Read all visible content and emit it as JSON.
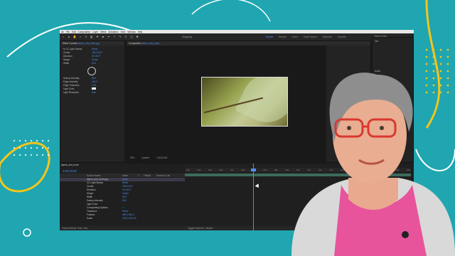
{
  "background": {
    "color": "#1fa6b0",
    "accent_yellow": "#f4c51c",
    "accent_white": "#ffffff"
  },
  "menu": [
    "Ae",
    "File",
    "Edit",
    "Composition",
    "Layer",
    "Effect",
    "Animation",
    "View",
    "Window",
    "Help"
  ],
  "toolbar": {
    "snapping": "Snapping"
  },
  "workspaces": [
    "Default",
    "Review",
    "Learn",
    "Small Screen",
    "Standard",
    "Libraries"
  ],
  "search_help": "Search Help",
  "effect_controls": {
    "tab_label": "Effect Controls",
    "layer_name": "layers_and_more.jpg",
    "rows": [
      {
        "label": "fx  CC Light Sweep",
        "value": "Reset"
      },
      {
        "label": "Center",
        "value": "196.0,91.0"
      },
      {
        "label": "Direction",
        "value": "0x+40.0°"
      },
      {
        "label": "Shape",
        "value": "Linear"
      },
      {
        "label": "Width",
        "value": "50.0"
      },
      {
        "label": "Sweep Intensity",
        "value": "50.0"
      },
      {
        "label": "Edge Intensity",
        "value": "100.0"
      },
      {
        "label": "Edge Thickness",
        "value": "2.00"
      },
      {
        "label": "Light Color",
        "value": ""
      },
      {
        "label": "Light Reception",
        "value": "Add"
      }
    ]
  },
  "composition": {
    "tab_label": "Composition",
    "comp_name": "layers_and_more",
    "breadcrumb": "layers_and_more",
    "footer": [
      "25%",
      "Quarter",
      "0;00;03;00"
    ]
  },
  "right_panel": {
    "items": [
      "Info",
      "Audio",
      "Preview",
      "Effects & Presets"
    ]
  },
  "timeline": {
    "tab_label": "layers_and_more",
    "timecode": "0;00;03;00",
    "columns": [
      "Source Name",
      "Mode",
      "T",
      "TrkMat",
      "Parent & Link"
    ],
    "layers": [
      {
        "name": "layers_and_more.jpg",
        "value": "None"
      },
      {
        "name": "CC Light Sweep",
        "value": "Reset"
      },
      {
        "name": "Center",
        "value": "196.0,91.0"
      },
      {
        "name": "Direction",
        "value": "0x+40.0°"
      },
      {
        "name": "Shape",
        "value": "Linear"
      },
      {
        "name": "Width",
        "value": "50.0"
      },
      {
        "name": "Sweep Intensity",
        "value": "50.0"
      },
      {
        "name": "Light Color",
        "value": ""
      },
      {
        "name": "Compositing Options",
        "value": "+ -"
      },
      {
        "name": "Transform",
        "value": "Reset"
      },
      {
        "name": "Position",
        "value": "960.0,540.0"
      },
      {
        "name": "Scale",
        "value": "100.0,100.0%"
      }
    ],
    "ruler_ticks": [
      "00s",
      "01s",
      "02s",
      "03s",
      "04s",
      "05s",
      "06s",
      "07s",
      "08s",
      "09s",
      "10s",
      "11s",
      "12s",
      "13s",
      "14s",
      "15s",
      "16s",
      "17s",
      "18s",
      "19s",
      "20s"
    ]
  },
  "status": {
    "label": "Frame Render Time: 0ms",
    "toggle": "Toggle Switches / Modes"
  }
}
